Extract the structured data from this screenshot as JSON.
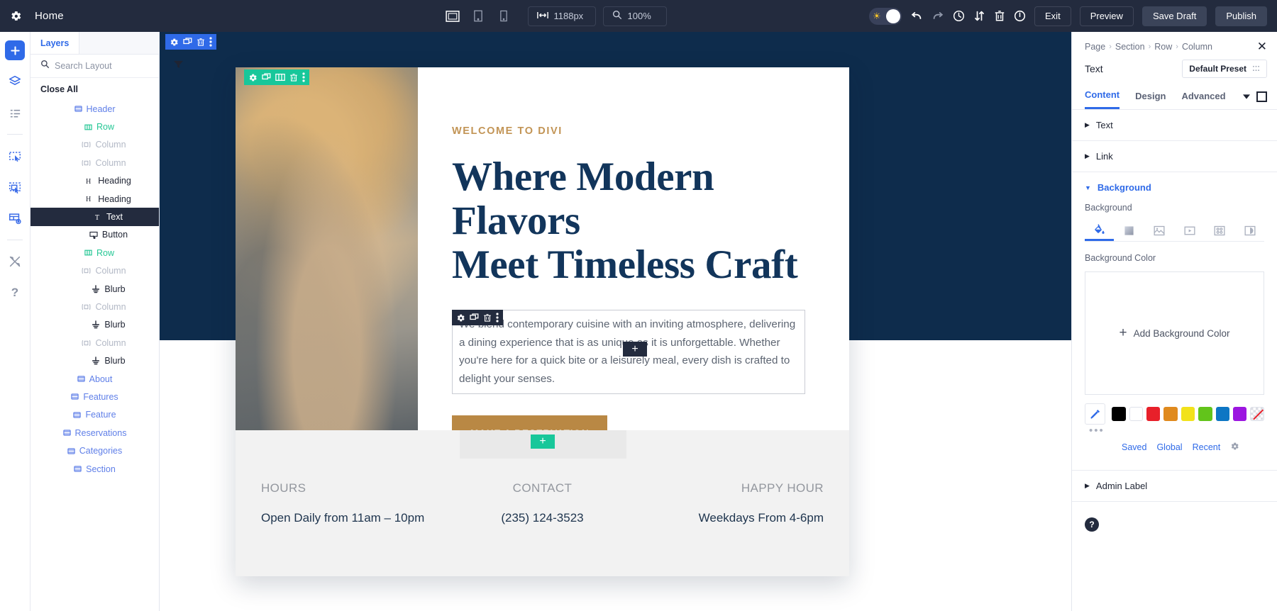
{
  "topbar": {
    "gear_icon": "gear-icon",
    "title": "Home",
    "devices": [
      {
        "name": "desktop",
        "label": "Desktop"
      },
      {
        "name": "tablet",
        "label": "Tablet"
      },
      {
        "name": "phone",
        "label": "Phone"
      }
    ],
    "width_value": "1188px",
    "zoom_value": "100%",
    "icons": [
      "undo-icon",
      "redo-icon",
      "history-icon",
      "portability-icon",
      "trash-icon",
      "power-icon"
    ],
    "buttons": {
      "exit": "Exit",
      "preview": "Preview",
      "save_draft": "Save Draft",
      "publish": "Publish"
    }
  },
  "rail": {
    "items": [
      {
        "name": "add-icon",
        "glyph": "+"
      },
      {
        "name": "layers-icon",
        "glyph": ""
      },
      {
        "name": "wireframe-icon",
        "glyph": ""
      },
      {
        "name": "select-module-icon",
        "glyph": ""
      },
      {
        "name": "multiselect-icon",
        "glyph": ""
      },
      {
        "name": "preview-layout-icon",
        "glyph": ""
      },
      {
        "name": "tools-icon",
        "glyph": ""
      },
      {
        "name": "help-icon",
        "glyph": "?"
      }
    ]
  },
  "layers": {
    "tab_label": "Layers",
    "search_placeholder": "Search Layout",
    "filter_icon": "filter-icon",
    "close_all": "Close All",
    "items": [
      {
        "label": "Header",
        "type": "section",
        "indent": 0,
        "icon": "section-icon",
        "selected": false
      },
      {
        "label": "Row",
        "type": "row",
        "indent": 1,
        "icon": "row-icon",
        "selected": false
      },
      {
        "label": "Column",
        "type": "column",
        "indent": 2,
        "icon": "column-icon",
        "selected": false
      },
      {
        "label": "Column",
        "type": "column",
        "indent": 2,
        "icon": "column-icon",
        "selected": false
      },
      {
        "label": "Heading",
        "type": "module",
        "indent": 3,
        "icon": "heading-icon",
        "selected": false
      },
      {
        "label": "Heading",
        "type": "module",
        "indent": 3,
        "icon": "heading-icon",
        "selected": false
      },
      {
        "label": "Text",
        "type": "module",
        "indent": 3,
        "icon": "text-icon",
        "selected": true
      },
      {
        "label": "Button",
        "type": "module",
        "indent": 3,
        "icon": "button-icon",
        "selected": false
      },
      {
        "label": "Row",
        "type": "row",
        "indent": 1,
        "icon": "row-icon",
        "selected": false
      },
      {
        "label": "Column",
        "type": "column",
        "indent": 2,
        "icon": "column-icon",
        "selected": false
      },
      {
        "label": "Blurb",
        "type": "module",
        "indent": 3,
        "icon": "blurb-icon",
        "selected": false
      },
      {
        "label": "Column",
        "type": "column",
        "indent": 2,
        "icon": "column-icon",
        "selected": false
      },
      {
        "label": "Blurb",
        "type": "module",
        "indent": 3,
        "icon": "blurb-icon",
        "selected": false
      },
      {
        "label": "Column",
        "type": "column",
        "indent": 2,
        "icon": "column-icon",
        "selected": false
      },
      {
        "label": "Blurb",
        "type": "module",
        "indent": 3,
        "icon": "blurb-icon",
        "selected": false
      },
      {
        "label": "About",
        "type": "section",
        "indent": 0,
        "icon": "section-icon",
        "selected": false
      },
      {
        "label": "Features",
        "type": "section",
        "indent": 0,
        "icon": "section-icon",
        "selected": false
      },
      {
        "label": "Feature",
        "type": "section",
        "indent": 0,
        "icon": "section-icon",
        "selected": false
      },
      {
        "label": "Reservations",
        "type": "section",
        "indent": 0,
        "icon": "section-icon",
        "selected": false
      },
      {
        "label": "Categories",
        "type": "section",
        "indent": 0,
        "icon": "section-icon",
        "selected": false
      },
      {
        "label": "Section",
        "type": "section",
        "indent": 0,
        "icon": "section-icon",
        "selected": false
      }
    ]
  },
  "canvas": {
    "hero": {
      "eyebrow": "WELCOME TO DIVI",
      "heading_line1": "Where Modern Flavors",
      "heading_line2": "Meet Timeless Craft",
      "paragraph": "We blend contemporary cuisine with an inviting atmosphere, delivering a dining experience that is as unique as it is unforgettable. Whether you're here for a quick bite or a leisurely meal, every dish is crafted to delight your senses.",
      "cta_label": "MAKE A RESERVATION"
    },
    "info": [
      {
        "title": "HOURS",
        "value": "Open Daily from 11am – 10pm"
      },
      {
        "title": "CONTACT",
        "value": "(235) 124-3523"
      },
      {
        "title": "HAPPY HOUR",
        "value": "Weekdays From 4-6pm"
      }
    ],
    "toolbar_icons": [
      "settings-icon",
      "duplicate-icon",
      "columns-icon",
      "delete-icon",
      "more-icon"
    ],
    "add_glyph": "+"
  },
  "settings": {
    "breadcrumb": [
      "Page",
      "Section",
      "Row",
      "Column"
    ],
    "breadcrumb_sep": "›",
    "close_icon": "close-icon",
    "module_title": "Text",
    "preset_label": "Default Preset",
    "preset_icon": "preset-icon",
    "tabs": [
      {
        "label": "Content",
        "active": true
      },
      {
        "label": "Design",
        "active": false
      },
      {
        "label": "Advanced",
        "active": false
      }
    ],
    "tabs_right_icons": [
      "chevron-down-icon",
      "expand-square-icon"
    ],
    "accordions": [
      {
        "label": "Text",
        "open": false
      },
      {
        "label": "Link",
        "open": false
      },
      {
        "label": "Background",
        "open": true
      }
    ],
    "background": {
      "label": "Background",
      "type_icons": [
        "color-fill-icon",
        "gradient-icon",
        "image-icon",
        "video-icon",
        "pattern-icon",
        "mask-icon"
      ],
      "color_label": "Background Color",
      "add_color_label": "Add Background Color",
      "add_color_glyph": "+",
      "eyedropper_icon": "eyedropper-icon",
      "more_icon": "more-dots-icon",
      "swatches": [
        "#000000",
        "#ffffff",
        "#e8202a",
        "#e08a1e",
        "#f2e21b",
        "#62c41b",
        "#0d76c4",
        "#9c16e0",
        "transparent"
      ],
      "links": [
        "Saved",
        "Global",
        "Recent"
      ],
      "gear_icon": "gear-icon"
    },
    "admin_label": "Admin Label",
    "help_glyph": "?"
  },
  "colors": {
    "topbar_bg": "#232b3e",
    "accent_blue": "#2f6ae8",
    "accent_green": "#18c79a",
    "navy": "#0e2c4c",
    "gold": "#b98844",
    "eyebrow_gold": "#c29455"
  }
}
